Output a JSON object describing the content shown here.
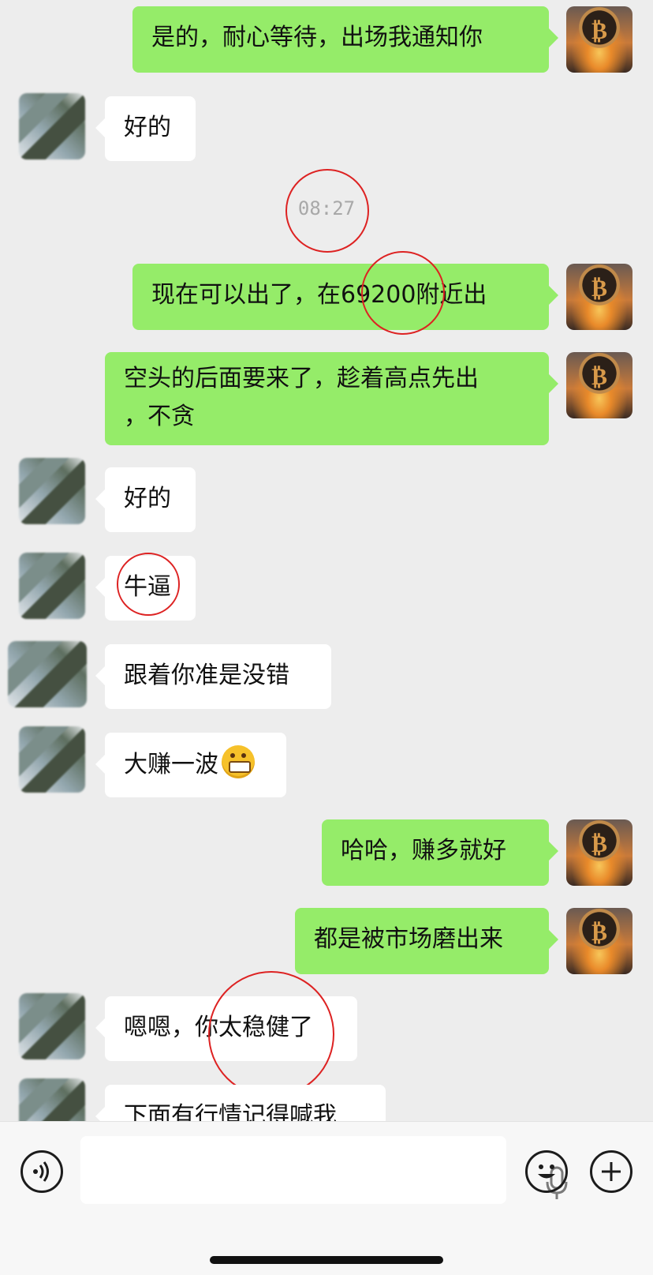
{
  "chat": {
    "messages": [
      {
        "from": "me",
        "text": "是的，耐心等待，出场我通知你"
      },
      {
        "from": "other",
        "text": "好的"
      },
      {
        "timestamp": "08:27"
      },
      {
        "from": "me",
        "text": "现在可以出了，在69200附近出"
      },
      {
        "from": "me",
        "text_line1": "空头的后面要来了，趁着高点先出",
        "text_line2": "，不贪"
      },
      {
        "from": "other",
        "text": "好的"
      },
      {
        "from": "other",
        "text": "牛逼"
      },
      {
        "from": "other",
        "text": "跟着你准是没错"
      },
      {
        "from": "other",
        "text": "大赚一波",
        "emoji": "grinning-face"
      },
      {
        "from": "me",
        "text": "哈哈，赚多就好"
      },
      {
        "from": "me",
        "text": "都是被市场磨出来"
      },
      {
        "from": "other",
        "text": "嗯嗯，你太稳健了"
      },
      {
        "from": "other",
        "text": "下面有行情记得喊我"
      }
    ],
    "avatar_self_icon": "bitcoin-sunset-icon",
    "avatar_other_icon": "blurred-avatar",
    "highlight_color": "#d22222",
    "bubble_me_color": "#95ec69",
    "bubble_other_color": "#ffffff"
  },
  "input_bar": {
    "voice_icon": "voice-icon",
    "mic_icon": "microphone-icon",
    "emoji_icon": "emoji-icon",
    "plus_icon": "plus-icon"
  }
}
